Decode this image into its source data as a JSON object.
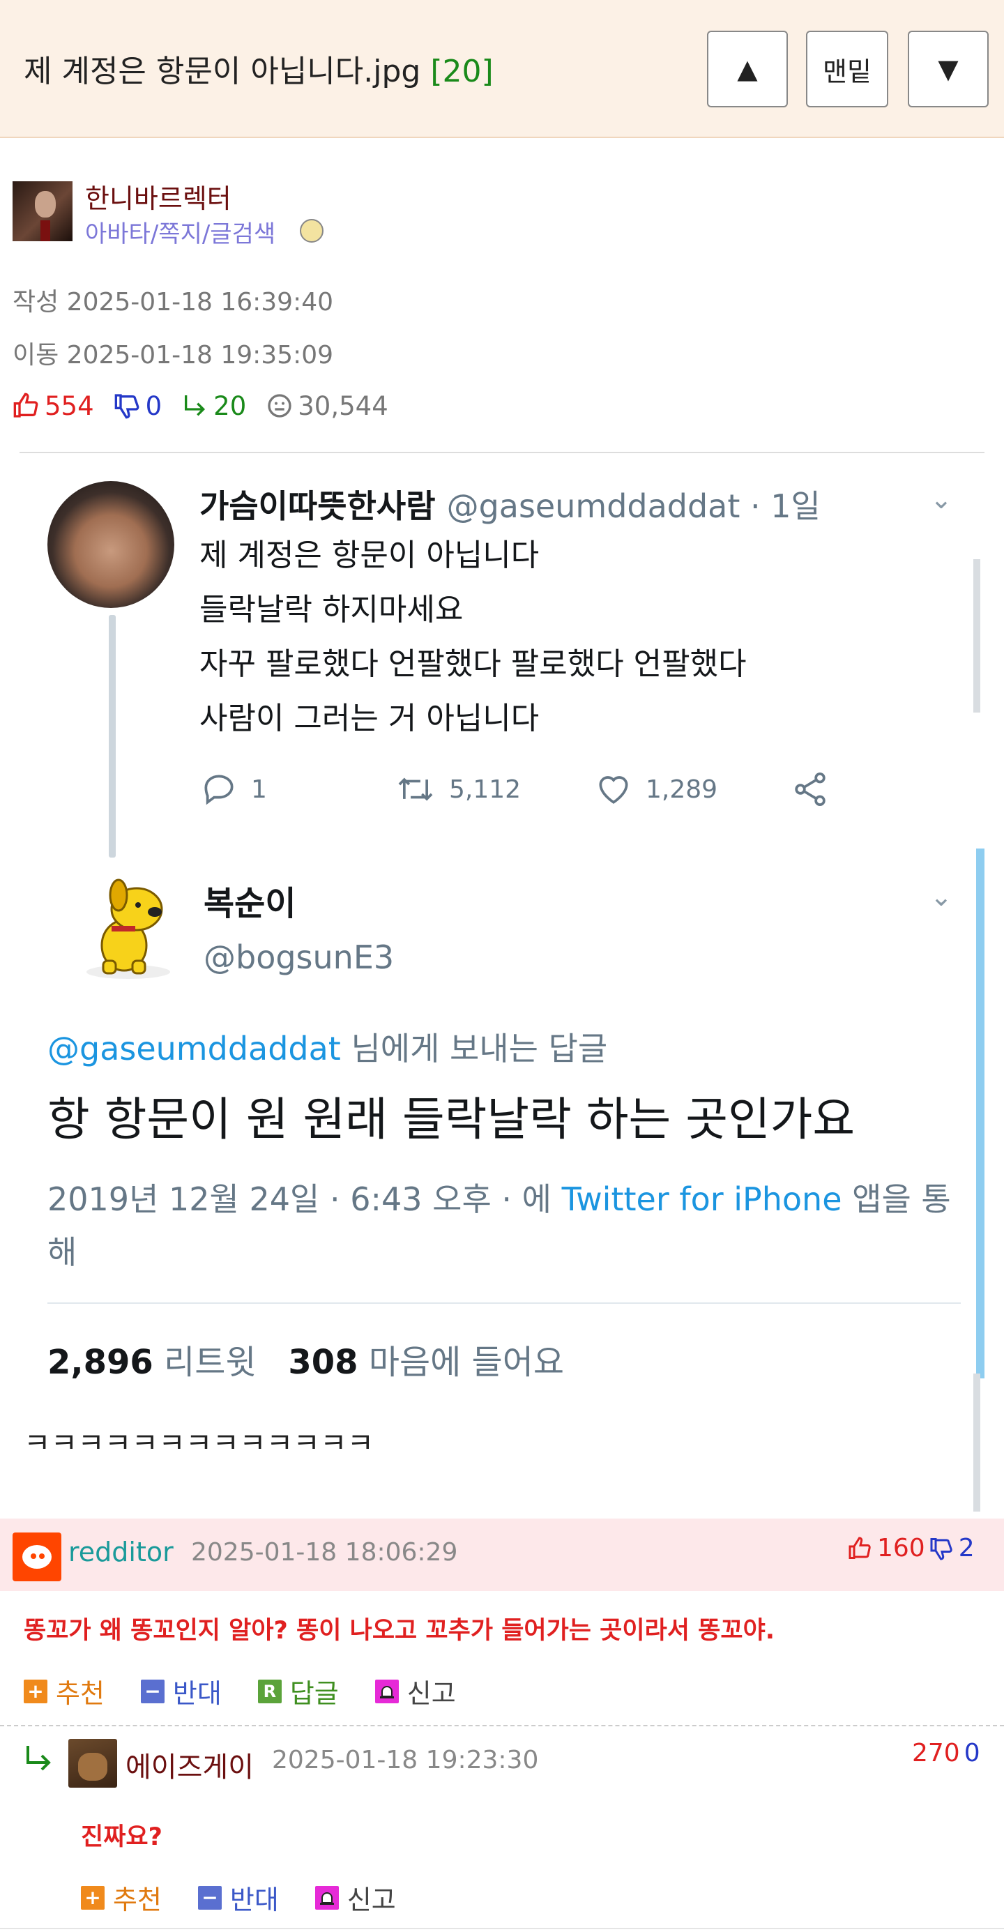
{
  "header": {
    "title": "제 계정은 항문이 아닙니다.jpg",
    "comment_count": "[20]",
    "btn_up": "▲",
    "btn_bottom": "맨밑",
    "btn_down": "▼"
  },
  "author": {
    "name": "한니바르렉터",
    "links": "아바타/쪽지/글검색"
  },
  "meta": {
    "written": "작성 2025-01-18 16:39:40",
    "moved": "이동 2025-01-18 19:35:09"
  },
  "stats": {
    "likes": "554",
    "dislikes": "0",
    "replies": "20",
    "views": "30,544"
  },
  "tweet": {
    "user1_name": "가슴이따뜻한사람",
    "user1_handle": "@gaseumddaddat · 1일",
    "body": [
      "제 계정은 항문이 아닙니다",
      "들락날락 하지마세요",
      "자꾸 팔로했다 언팔했다 팔로했다 언팔했다",
      "사람이 그러는 거 아닙니다"
    ],
    "actions": {
      "reply": "1",
      "retweet": "5,112",
      "like": "1,289"
    },
    "user2_name": "복순이",
    "user2_handle": "@bogsunE3",
    "reply_to_handle": "@gaseumddaddat",
    "reply_to_suffix": " 님에게 보내는 답글",
    "main_text": "항 항문이 원 원래 들락날락 하는 곳인가요",
    "date_prefix": "2019년 12월 24일 · 6:43 오후 · 에 ",
    "date_source": "Twitter for iPhone",
    "date_suffix": " 앱을 통해",
    "retweets_num": "2,896",
    "retweets_label": " 리트윗",
    "likes_num": "308",
    "likes_label": " 마음에 들어요"
  },
  "post_text": "ㅋㅋㅋㅋㅋㅋㅋㅋㅋㅋㅋㅋㅋ",
  "comments": [
    {
      "name": "redditor",
      "date": "2025-01-18 18:06:29",
      "up": "160",
      "down": "2",
      "text": "똥꼬가 왜 똥꼬인지 알아? 똥이 나오고 꼬추가 들어가는 곳이라서 똥꼬야.",
      "btn_up": "추천",
      "btn_down": "반대",
      "btn_reply": "답글",
      "btn_report": "신고"
    },
    {
      "name": "에이즈게이",
      "date": "2025-01-18 19:23:30",
      "up": "270",
      "down": "0",
      "text": "진짜요?",
      "btn_up": "추천",
      "btn_down": "반대",
      "btn_report": "신고"
    }
  ],
  "colors": {
    "header_bg": "#fcf1e6",
    "like_red": "#e02020",
    "dislike_blue": "#2438c8",
    "reply_green": "#1a8a1a",
    "twitter_blue": "#1b95e0",
    "highlight_bg": "#fde8ea"
  }
}
